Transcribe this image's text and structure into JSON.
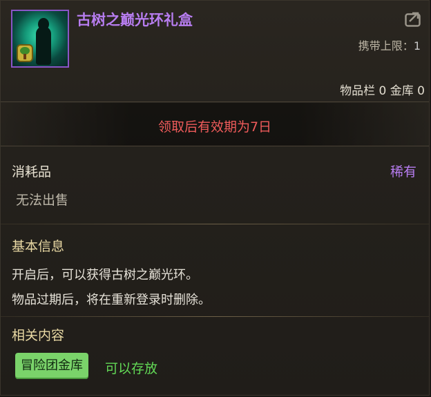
{
  "item": {
    "name": "古树之巅光环礼盒",
    "carry_limit_label": "携带上限：",
    "carry_limit_value": "1",
    "storage": "物品栏 0 金库 0",
    "validity": "领取后有效期为7日",
    "type": "消耗品",
    "rarity": "稀有",
    "sell_status": "无法出售"
  },
  "basic_info": {
    "title": "基本信息",
    "lines": [
      "开启后，可以获得古树之巅光环。",
      "物品过期后，将在重新登录时删除。"
    ]
  },
  "related": {
    "title": "相关内容",
    "tag_label": "冒险团金库",
    "tag_note": "可以存放"
  },
  "colors": {
    "title": "#b77df0",
    "validity": "#ef5b5b",
    "section_title": "#e9d9a4",
    "tag_bg": "#7ad36a",
    "tag_note": "#62d956"
  },
  "icons": {
    "item_icon": "tree-aura-box-icon",
    "share": "share-icon"
  }
}
